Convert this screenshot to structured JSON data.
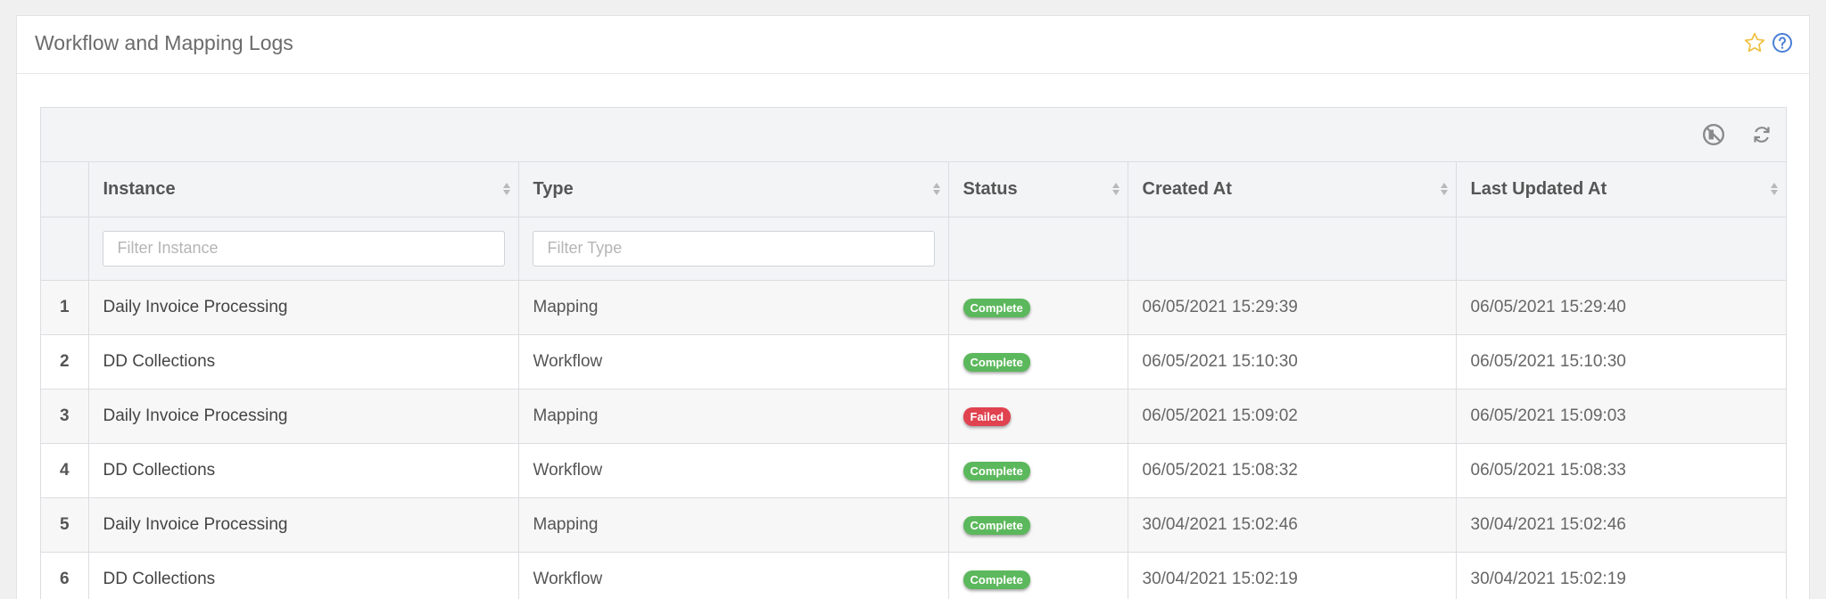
{
  "panel": {
    "title": "Workflow and Mapping Logs"
  },
  "icons": {
    "favorite": "star-icon",
    "help": "question-circle-icon",
    "columns": "columns-toggle-icon",
    "refresh": "refresh-icon"
  },
  "colors": {
    "complete": "#5cb85c",
    "failed": "#e0424f",
    "star": "#f0c040",
    "help": "#4a7fd6"
  },
  "table": {
    "headers": [
      "Instance",
      "Type",
      "Status",
      "Created At",
      "Last Updated At"
    ],
    "filters": {
      "instance_placeholder": "Filter Instance",
      "type_placeholder": "Filter Type"
    },
    "rows": [
      {
        "index": "1",
        "instance": "Daily Invoice Processing",
        "type": "Mapping",
        "status": "Complete",
        "created": "06/05/2021 15:29:39",
        "updated": "06/05/2021 15:29:40"
      },
      {
        "index": "2",
        "instance": "DD Collections",
        "type": "Workflow",
        "status": "Complete",
        "created": "06/05/2021 15:10:30",
        "updated": "06/05/2021 15:10:30"
      },
      {
        "index": "3",
        "instance": "Daily Invoice Processing",
        "type": "Mapping",
        "status": "Failed",
        "created": "06/05/2021 15:09:02",
        "updated": "06/05/2021 15:09:03"
      },
      {
        "index": "4",
        "instance": "DD Collections",
        "type": "Workflow",
        "status": "Complete",
        "created": "06/05/2021 15:08:32",
        "updated": "06/05/2021 15:08:33"
      },
      {
        "index": "5",
        "instance": "Daily Invoice Processing",
        "type": "Mapping",
        "status": "Complete",
        "created": "30/04/2021 15:02:46",
        "updated": "30/04/2021 15:02:46"
      },
      {
        "index": "6",
        "instance": "DD Collections",
        "type": "Workflow",
        "status": "Complete",
        "created": "30/04/2021 15:02:19",
        "updated": "30/04/2021 15:02:19"
      }
    ]
  }
}
